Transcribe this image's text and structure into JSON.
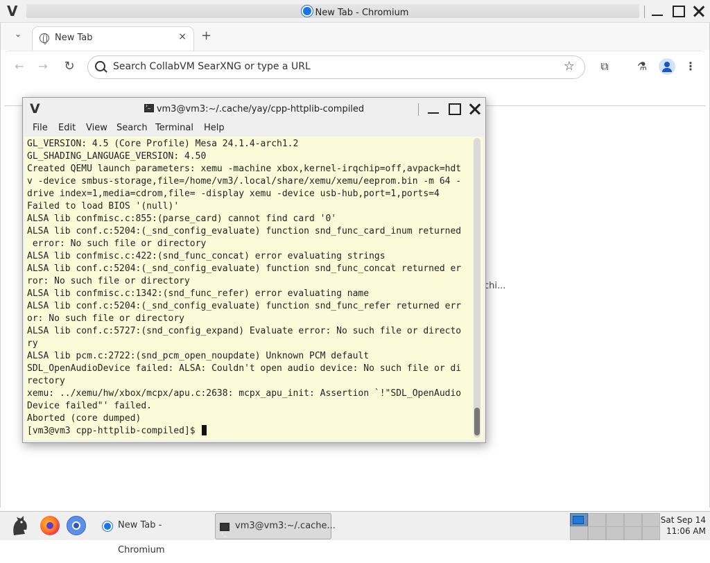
{
  "chrome": {
    "window_title": "New Tab - Chromium",
    "wm_logo": "V",
    "tab": {
      "label": "New Tab",
      "close": "×"
    },
    "new_tab": "+",
    "tab_dropdown": "⌄",
    "omnibox": {
      "placeholder": "Search CollabVM SearXNG or type a URL"
    },
    "bookmark_star": "☆",
    "menu": "⋮",
    "peek_text": "chi..."
  },
  "terminal": {
    "title": "vm3@vm3:~/.cache/yay/cpp-httplib-compiled",
    "wm_logo": "V",
    "menu": [
      "File",
      "Edit",
      "View",
      "Search",
      "Terminal",
      "Help"
    ],
    "lines": [
      "GL_VERSION: 4.5 (Core Profile) Mesa 24.1.4-arch1.2",
      "GL_SHADING_LANGUAGE_VERSION: 4.50",
      "Created QEMU launch parameters: xemu -machine xbox,kernel-irqchip=off,avpack=hdt",
      "v -device smbus-storage,file=/home/vm3/.local/share/xemu/xemu/eeprom.bin -m 64 -",
      "drive index=1,media=cdrom,file= -display xemu -device usb-hub,port=1,ports=4",
      "Failed to load BIOS '(null)'",
      "ALSA lib confmisc.c:855:(parse_card) cannot find card '0'",
      "ALSA lib conf.c:5204:(_snd_config_evaluate) function snd_func_card_inum returned",
      " error: No such file or directory",
      "ALSA lib confmisc.c:422:(snd_func_concat) error evaluating strings",
      "ALSA lib conf.c:5204:(_snd_config_evaluate) function snd_func_concat returned er",
      "ror: No such file or directory",
      "ALSA lib confmisc.c:1342:(snd_func_refer) error evaluating name",
      "ALSA lib conf.c:5204:(_snd_config_evaluate) function snd_func_refer returned err",
      "or: No such file or directory",
      "ALSA lib conf.c:5727:(snd_config_expand) Evaluate error: No such file or directo",
      "ry",
      "ALSA lib pcm.c:2722:(snd_pcm_open_noupdate) Unknown PCM default",
      "SDL_OpenAudioDevice failed: ALSA: Couldn't open audio device: No such file or di",
      "rectory",
      "xemu: ../xemu/hw/xbox/mcpx/apu.c:2638: mcpx_apu_init: Assertion `!\"SDL_OpenAudio",
      "Device failed\"' failed.",
      "Aborted (core dumped)"
    ],
    "prompt": "[vm3@vm3 cpp-httplib-compiled]$ "
  },
  "taskbar": {
    "items": [
      {
        "label": "New Tab - Chromium",
        "active": false,
        "icon": "chromium-icon"
      },
      {
        "label": "vm3@vm3:~/.cache...",
        "active": true,
        "icon": "terminal-icon"
      }
    ],
    "clock": {
      "date": "Sat Sep 14",
      "time": "11:06 AM"
    }
  },
  "colors": {
    "terminal_bg": "#fbfbd9",
    "accent": "#1a73e8",
    "pager_active": "#1f7bd6"
  }
}
